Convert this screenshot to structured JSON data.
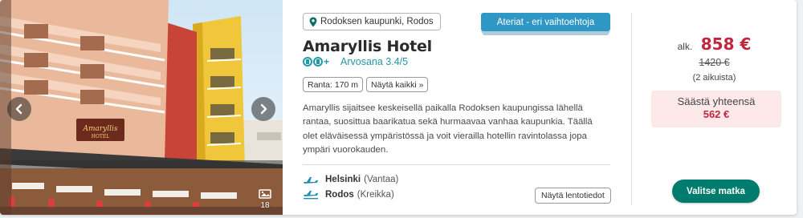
{
  "gallery": {
    "count": "18",
    "hotel_sign": "Amaryllis",
    "hotel_sign_sub": "HOTEL"
  },
  "location": {
    "label": "Rodoksen kaupunki, Rodos"
  },
  "meal_badge": "Ateriat - eri vaihtoehtoja",
  "hotel": {
    "name": "Amaryllis Hotel",
    "rating_icons_text": "+",
    "rating_label": "Arvosana 3.4/5",
    "chips": [
      "Ranta: 170 m",
      "Näytä kaikki »"
    ],
    "description": "Amaryllis sijaitsee keskeisellä paikalla Rodoksen kaupungissa lähellä rantaa, suosittua baarikatua sekä hurmaavaa vanhaa kaupunkia. Täällä olet eläväisessä ympäristössä ja voit vierailla hotellin ravintolassa jopa ympäri vuorokauden."
  },
  "flights": {
    "outbound": {
      "city": "Helsinki",
      "airport": "(Vantaa)"
    },
    "return": {
      "city": "Rodos",
      "airport": "(Kreikka)"
    },
    "details_button": "Näytä lentotiedot"
  },
  "price": {
    "from_label": "alk.",
    "amount": "858 €",
    "old_amount": "1420 €",
    "pax": "(2 aikuista)",
    "save_label": "Säästä yhteensä",
    "save_amount": "562 €",
    "choose_button": "Valitse matka"
  },
  "colors": {
    "accent_teal": "#007c6f",
    "badge_blue": "#2e97c4",
    "price_red": "#c0273f",
    "rating_teal": "#1f9aa8"
  }
}
